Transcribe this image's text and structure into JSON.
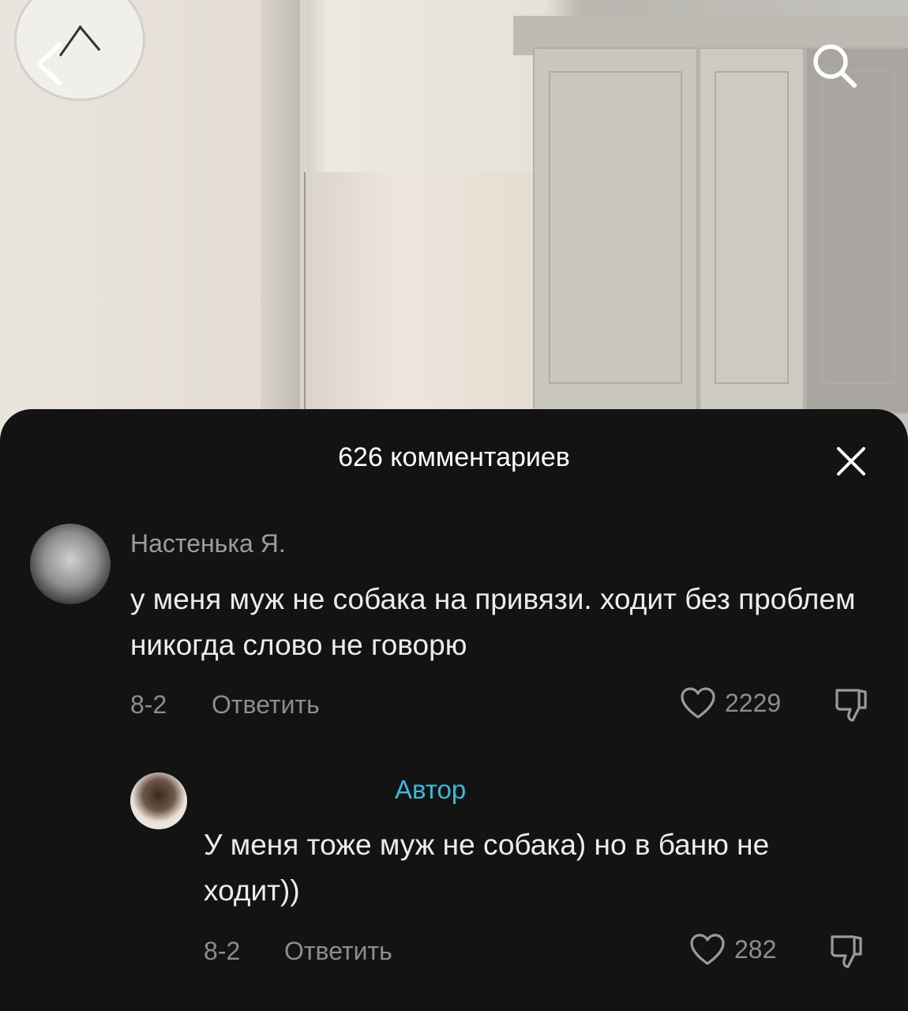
{
  "header": {
    "back_icon": "chevron-left-icon",
    "search_icon": "search-icon"
  },
  "comments_sheet": {
    "title": "626 комментариев",
    "close_icon": "close-icon"
  },
  "comments": [
    {
      "username": "Настенька Я.",
      "text": "у меня муж не собака на привязи. ходит без проблем никогда слово не говорю",
      "date": "8-2",
      "reply_label": "Ответить",
      "likes": "2229"
    },
    {
      "username_label": "Автор",
      "text": "У меня тоже муж не собака) но в баню не ходит))",
      "date": "8-2",
      "reply_label": "Ответить",
      "likes": "282"
    }
  ],
  "colors": {
    "sheet_bg": "#131313",
    "author_label": "#3fb7d8",
    "muted_text": "#8d8d8d"
  }
}
